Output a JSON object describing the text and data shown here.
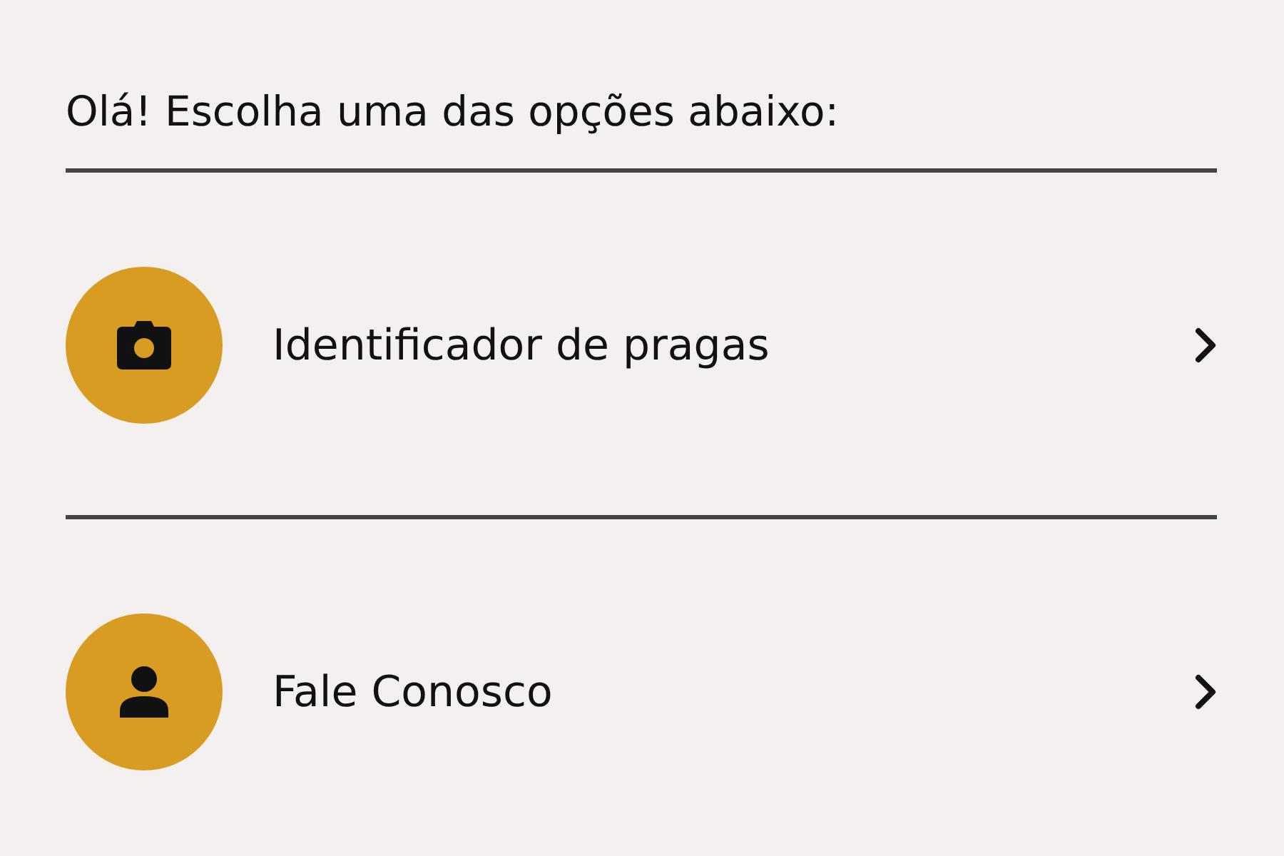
{
  "greeting": "Olá! Escolha uma das opções abaixo:",
  "options": [
    {
      "kind": "camera",
      "label": "Identificador de pragas"
    },
    {
      "kind": "person",
      "label": "Fale Conosco"
    }
  ]
}
